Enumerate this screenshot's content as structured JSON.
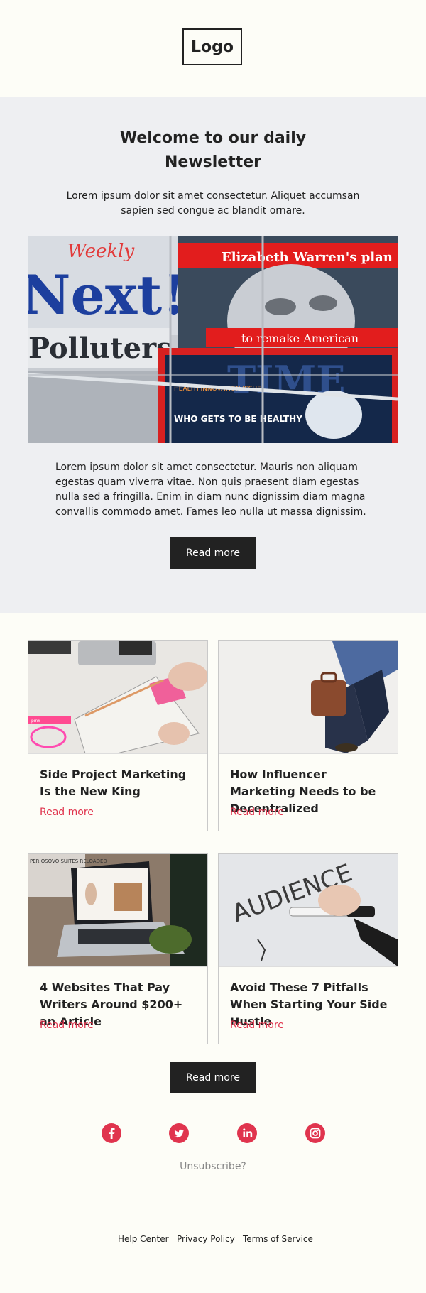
{
  "header": {
    "logo": "Logo"
  },
  "hero": {
    "title": "Welcome to our daily Newsletter",
    "intro": "Lorem ipsum dolor sit amet consectetur. Aliquet accumsan sapien sed congue ac blandit ornare.",
    "image_icon": "magazine-rack-photo",
    "image_texts": {
      "weekly": "Weekly",
      "next": "Next!",
      "polluters": "Polluters",
      "warren": "Elizabeth Warren's plan",
      "remake": "to remake American",
      "time": "TIME",
      "health": "HEALTH INNOVATION ISSUE",
      "who": "WHO GETS TO BE HEALTHY"
    },
    "body": "Lorem ipsum dolor sit amet consectetur. Mauris non aliquam egestas quam viverra vitae. Non quis praesent diam egestas nulla sed a fringilla. Enim in diam nunc dignissim diam magna convallis commodo amet. Fames leo nulla ut massa dignissim.",
    "button": "Read more"
  },
  "articles": [
    {
      "title": "Side Project Marketing Is the New King",
      "link": "Read more",
      "image": "planner-desk-photo"
    },
    {
      "title": "How Influencer Marketing Needs to be Decentralized",
      "link": "Read more",
      "image": "briefcase-walker-photo"
    },
    {
      "title": "4 Websites That Pay Writers Around $200+ an Article",
      "link": "Read more",
      "image": "laptop-website-photo"
    },
    {
      "title": "Avoid These 7 Pitfalls When Starting Your Side Hustle",
      "link": "Read more",
      "image": "whiteboard-marker-photo"
    }
  ],
  "article_image_texts": {
    "laptop_sign": "PER OSOVO SUITES RELOADED",
    "whiteboard_word": "AUDIENCE"
  },
  "more_button": "Read more",
  "social": [
    "facebook-icon",
    "twitter-icon",
    "linkedin-icon",
    "instagram-icon"
  ],
  "unsubscribe": "Unsubscribe?",
  "footer": {
    "links": [
      "Help Center",
      "Privacy Policy",
      "Terms of Service"
    ]
  },
  "colors": {
    "accent": "#e0344e",
    "dark": "#222222",
    "hero_bg": "#eeeff2",
    "page_bg": "#fdfdf7"
  }
}
